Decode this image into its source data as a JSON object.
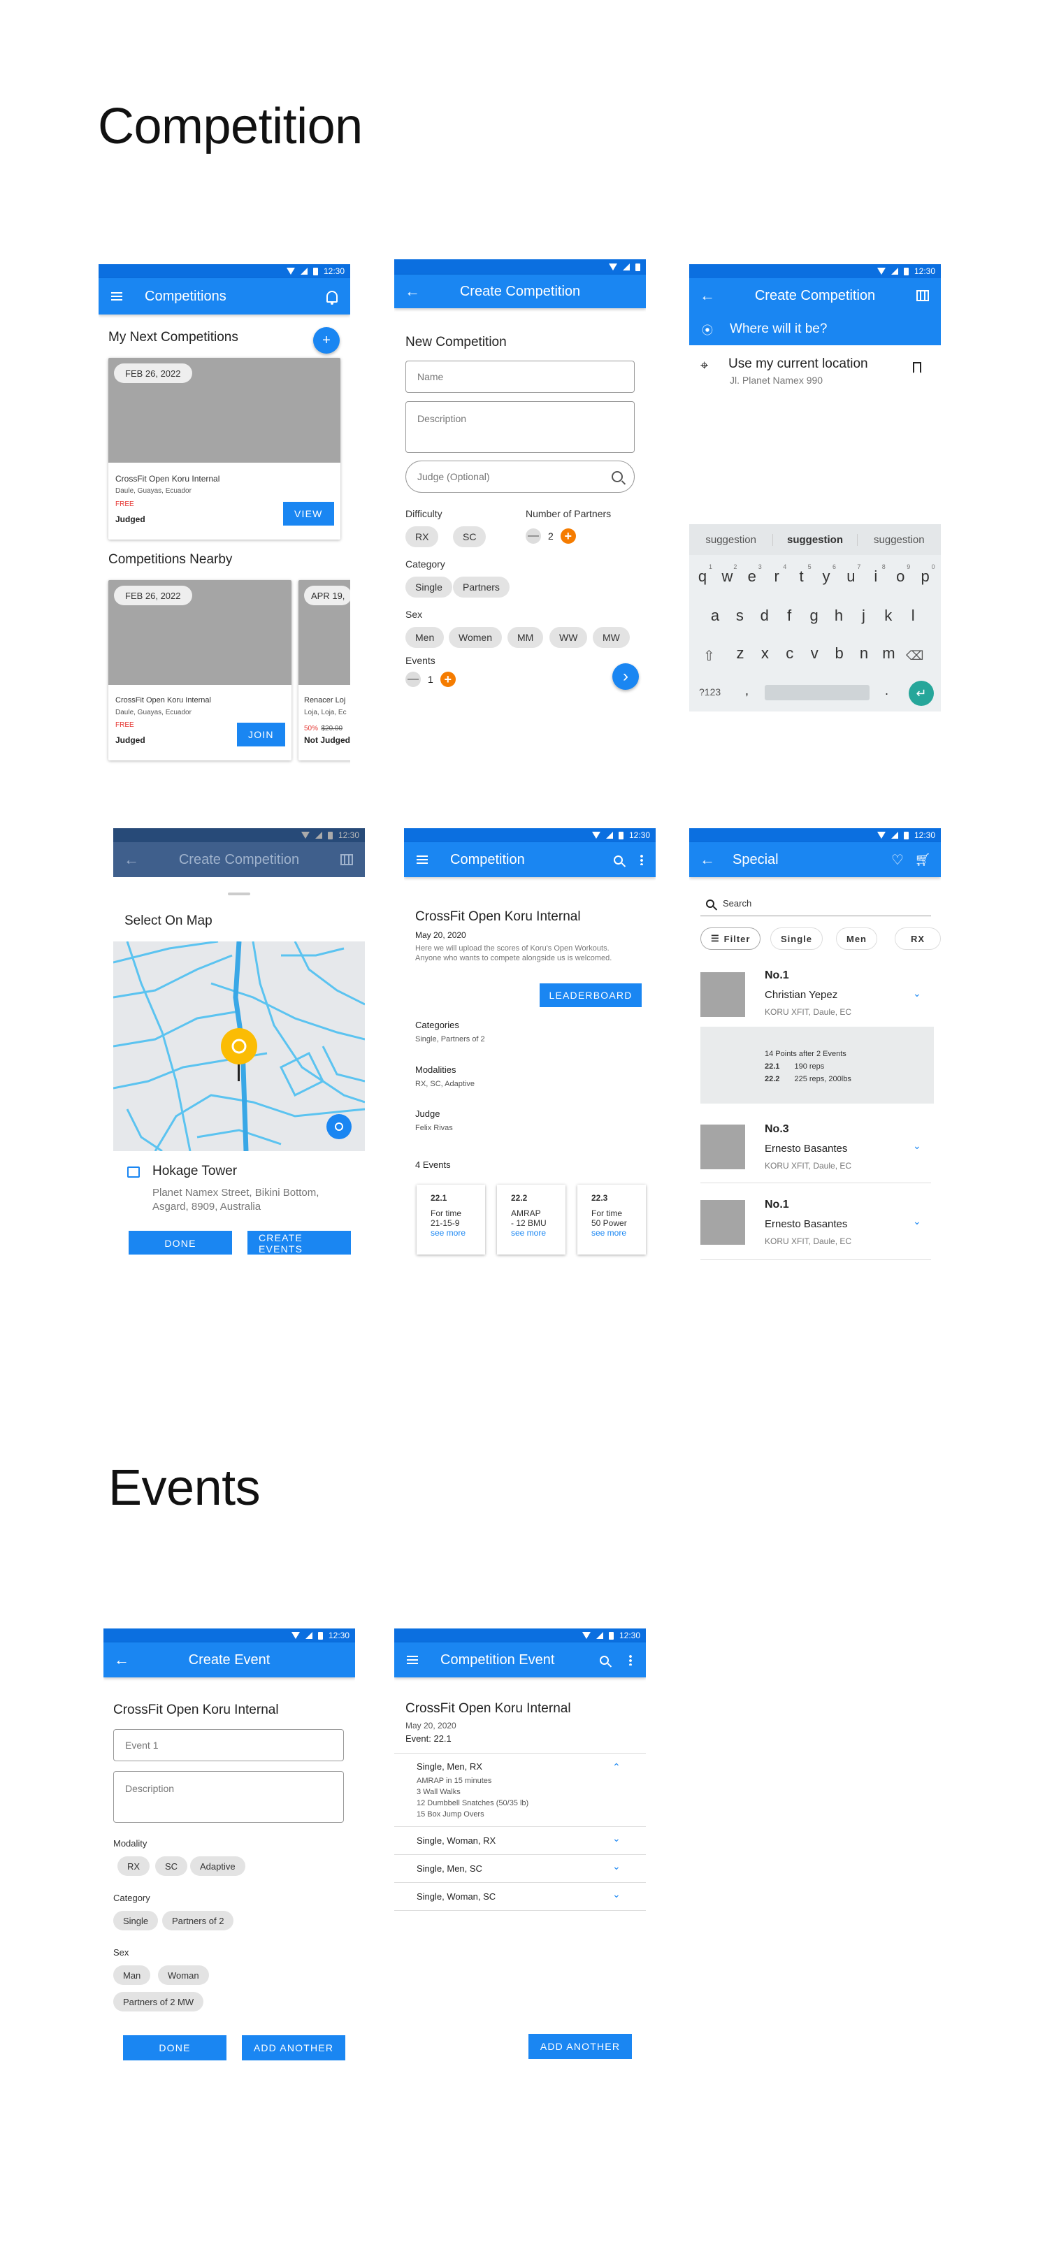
{
  "sections": {
    "competition_title": "Competition",
    "events_title": "Events"
  },
  "status_time": "12:30",
  "s1": {
    "title": "Competitions",
    "my_next": "My Next Competitions",
    "add": "+",
    "card1": {
      "date": "FEB 26, 2022",
      "name": "CrossFit Open Koru Internal",
      "location": "Daule, Guayas, Ecuador",
      "price": "FREE",
      "status": "Judged",
      "button": "VIEW"
    },
    "nearby": "Competitions Nearby",
    "card2": {
      "date": "FEB 26, 2022",
      "name": "CrossFit Open Koru Internal",
      "location": "Daule, Guayas, Ecuador",
      "price": "FREE",
      "status": "Judged",
      "button": "JOIN"
    },
    "card3": {
      "date": "APR 19,",
      "name": "Renacer Loj",
      "location": "Loja, Loja, Ec",
      "discount": "50%",
      "old_price": "$20.00",
      "status": "Not Judged"
    }
  },
  "s2": {
    "title": "Create Competition",
    "heading": "New Competition",
    "name_ph": "Name",
    "desc_ph": "Description",
    "judge_ph": "Judge (Optional)",
    "difficulty": "Difficulty",
    "diff_chips": [
      "RX",
      "SC"
    ],
    "partners": "Number of Partners",
    "partners_value": "2",
    "category": "Category",
    "cat_chips": [
      "Single",
      "Partners"
    ],
    "sex": "Sex",
    "sex_chips": [
      "Men",
      "Women",
      "MM",
      "WW",
      "MW"
    ],
    "events": "Events",
    "events_value": "1",
    "minus": "—",
    "plus": "+",
    "next": "›"
  },
  "s3": {
    "title": "Create Competition",
    "search_value": "Where will it be?",
    "current": "Use my current location",
    "address": "Jl. Planet Namex 990",
    "suggestions": [
      "suggestion",
      "suggestion",
      "suggestion"
    ],
    "row1": [
      "q",
      "w",
      "e",
      "r",
      "t",
      "y",
      "u",
      "i",
      "o",
      "p"
    ],
    "row1_nums": [
      "1",
      "2",
      "3",
      "4",
      "5",
      "6",
      "7",
      "8",
      "9",
      "0"
    ],
    "row2": [
      "a",
      "s",
      "d",
      "f",
      "g",
      "h",
      "j",
      "k",
      "l"
    ],
    "row3": [
      "z",
      "x",
      "c",
      "v",
      "b",
      "n",
      "m"
    ],
    "sym": "?123",
    "comma": ",",
    "period": "."
  },
  "s4": {
    "title": "Create Competition",
    "select": "Select On Map",
    "place": "Hokage Tower",
    "place_addr": "Planet Namex Street, Bikini Bottom, Asgard, 8909, Australia",
    "done": "DONE",
    "create": "CREATE EVENTS"
  },
  "s5": {
    "title": "Competition",
    "name": "CrossFit Open Koru Internal",
    "date": "May 20, 2020",
    "desc": "Here we will upload the scores of Koru's Open Workouts. Anyone who wants to compete alongside us is welcomed.",
    "leaderboard": "LEADERBOARD",
    "categories_label": "Categories",
    "categories": "Single, Partners of 2",
    "modalities_label": "Modalities",
    "modalities": "RX, SC, Adaptive",
    "judge_label": "Judge",
    "judge": "Felix Rivas",
    "events_count": "4 Events",
    "events": [
      {
        "id": "22.1",
        "l1": "For time",
        "l2": "21-15-9",
        "more": "see more"
      },
      {
        "id": "22.2",
        "l1": "AMRAP",
        "l2": "- 12 BMU",
        "more": "see more"
      },
      {
        "id": "22.3",
        "l1": "For time",
        "l2": "50 Power",
        "more": "see more"
      }
    ]
  },
  "s6": {
    "title": "Special",
    "search_ph": "Search",
    "filter": "Filter",
    "chips": [
      "Single",
      "Men",
      "RX"
    ],
    "rows": [
      {
        "rank": "No.1",
        "name": "Christian Yepez",
        "gym": "KORU XFIT, Daule, EC"
      },
      {
        "rank": "No.3",
        "name": "Ernesto Basantes",
        "gym": "KORU XFIT, Daule, EC"
      },
      {
        "rank": "No.1",
        "name": "Ernesto Basantes",
        "gym": "KORU XFIT, Daule, EC"
      }
    ],
    "detail": {
      "points": "14 Points after 2 Events",
      "e1": "22.1",
      "e1v": "190 reps",
      "e2": "22.2",
      "e2v": "225 reps, 200lbs"
    }
  },
  "s7": {
    "title": "Create Event",
    "heading": "CrossFit Open Koru Internal",
    "event_ph": "Event 1",
    "desc_ph": "Description",
    "modality": "Modality",
    "mod_chips": [
      "RX",
      "SC",
      "Adaptive"
    ],
    "category": "Category",
    "cat_chips": [
      "Single",
      "Partners of 2"
    ],
    "sex": "Sex",
    "sex_chips": [
      "Man",
      "Woman",
      "Partners of 2 MW"
    ],
    "done": "DONE",
    "add": "ADD ANOTHER"
  },
  "s8": {
    "title": "Competition Event",
    "heading": "CrossFit Open Koru Internal",
    "date": "May 20, 2020",
    "event": "Event: 22.1",
    "groups": [
      "Single, Men, RX",
      "Single, Woman, RX",
      "Single, Men, SC",
      "Single, Woman, SC"
    ],
    "details": [
      "AMRAP in 15 minutes",
      "3 Wall Walks",
      "12 Dumbbell Snatches (50/35 lb)",
      "15 Box Jump Overs"
    ],
    "add": "ADD ANOTHER"
  },
  "colors": {
    "primary": "#1a86f2",
    "status": "#0b6fe0",
    "accent": "#f57c00",
    "teal": "#26a69a"
  }
}
